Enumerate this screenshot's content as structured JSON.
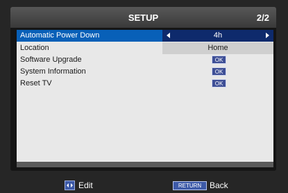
{
  "header": {
    "title": "SETUP",
    "page": "2/2"
  },
  "menu": [
    {
      "label": "Automatic Power Down",
      "value": "4h",
      "type": "selector"
    },
    {
      "label": "Location",
      "value": "Home",
      "type": "text"
    },
    {
      "label": "Software Upgrade",
      "value": "OK",
      "type": "button"
    },
    {
      "label": "System Information",
      "value": "OK",
      "type": "button"
    },
    {
      "label": "Reset TV",
      "value": "OK",
      "type": "button"
    }
  ],
  "footer": {
    "edit_label": "Edit",
    "return_key": "RETURN",
    "back_label": "Back"
  },
  "colors": {
    "highlight": "#0860b8",
    "value_highlight": "#0e2a6c",
    "ok_button": "#3e4f96"
  }
}
